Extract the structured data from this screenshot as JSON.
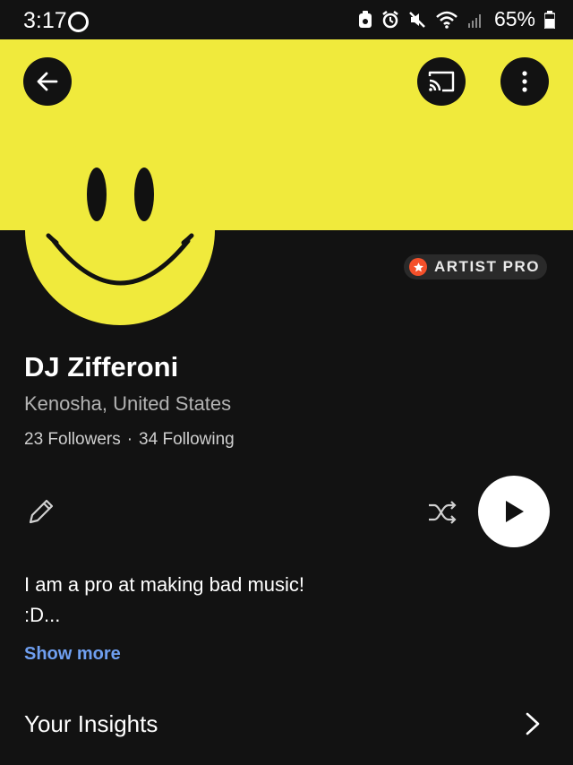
{
  "status_bar": {
    "time": "3:17",
    "battery": "65%"
  },
  "colors": {
    "banner": "#f0ea3c",
    "background": "#121212",
    "accent_link": "#6f9ff0",
    "pro_star": "#f5502a"
  },
  "header": {
    "back_icon": "arrow-left-icon",
    "cast_icon": "cast-icon",
    "more_icon": "more-vertical-icon"
  },
  "badge": {
    "label": "ARTIST PRO",
    "icon": "star-icon"
  },
  "profile": {
    "avatar_icon": "smiley-face",
    "name": "DJ Zifferoni",
    "location": "Kenosha, United States",
    "followers": "23 Followers",
    "separator": "·",
    "following": "34 Following"
  },
  "actions": {
    "edit_icon": "pencil-icon",
    "shuffle_icon": "shuffle-icon",
    "play_icon": "play-icon"
  },
  "bio": {
    "line1": "I am a pro at making bad music!",
    "line2": ":D...",
    "show_more": "Show more"
  },
  "insights": {
    "label": "Your Insights",
    "icon": "chevron-right-icon"
  }
}
